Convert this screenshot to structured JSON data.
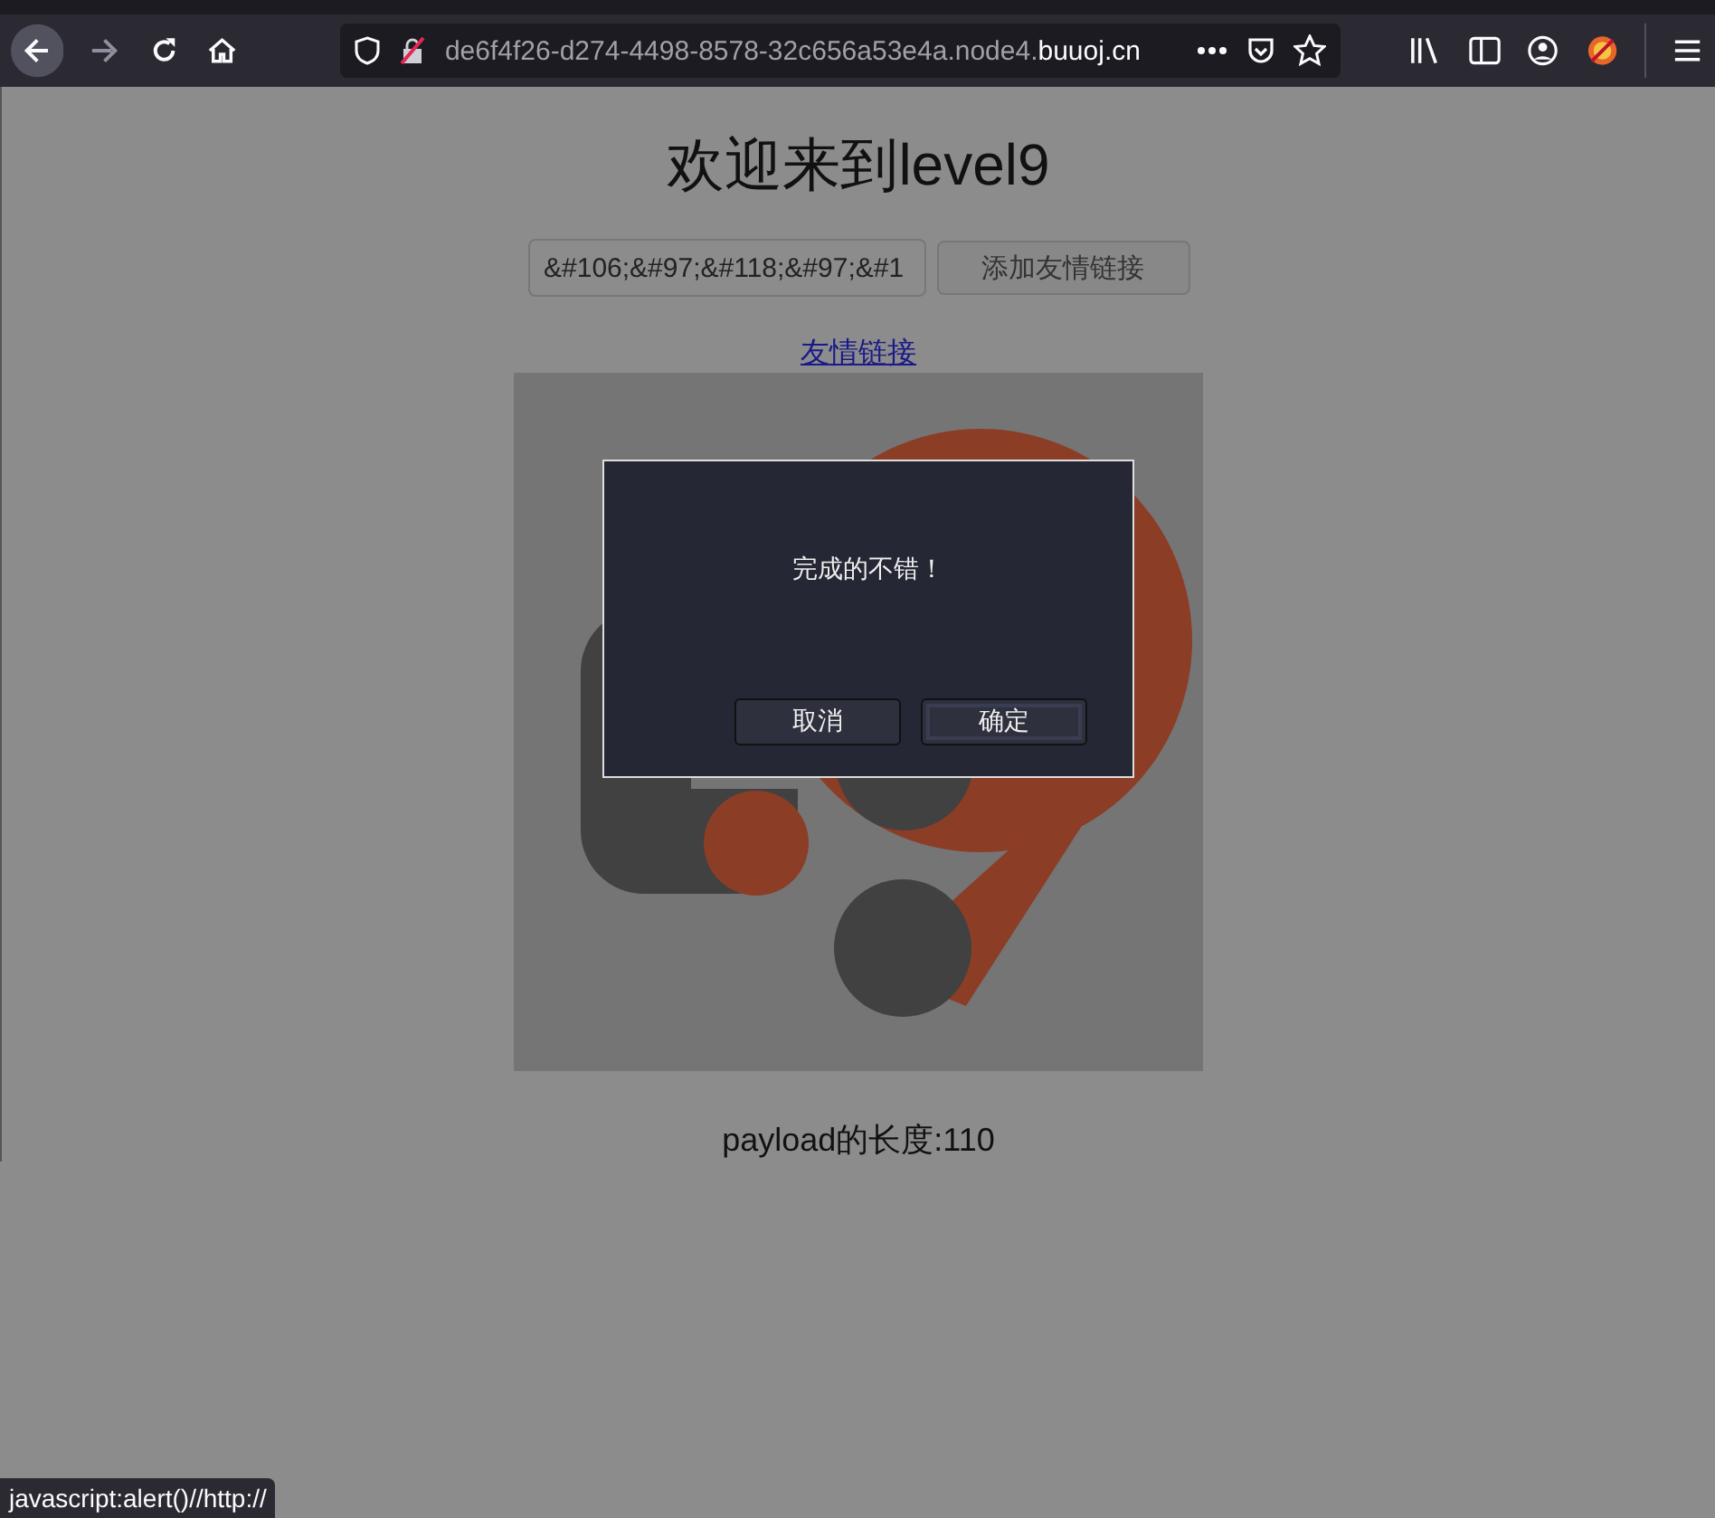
{
  "browser": {
    "url_subdomain": "de6f4f26-d274-4498-8578-32c656a53e4a.node4.",
    "url_domain": "buuoj.cn"
  },
  "page": {
    "title": "欢迎来到level9",
    "input_value": "&#106;&#97;&#118;&#97;&#1",
    "add_button": "添加友情链接",
    "link": "友情链接",
    "payload_length": "payload的长度:110"
  },
  "dialog": {
    "message": "完成的不错！",
    "buttons": [
      {
        "label": "取消",
        "focused": false
      },
      {
        "label": "确定",
        "focused": true
      }
    ]
  },
  "status_bar": "javascript:alert()//http://"
}
